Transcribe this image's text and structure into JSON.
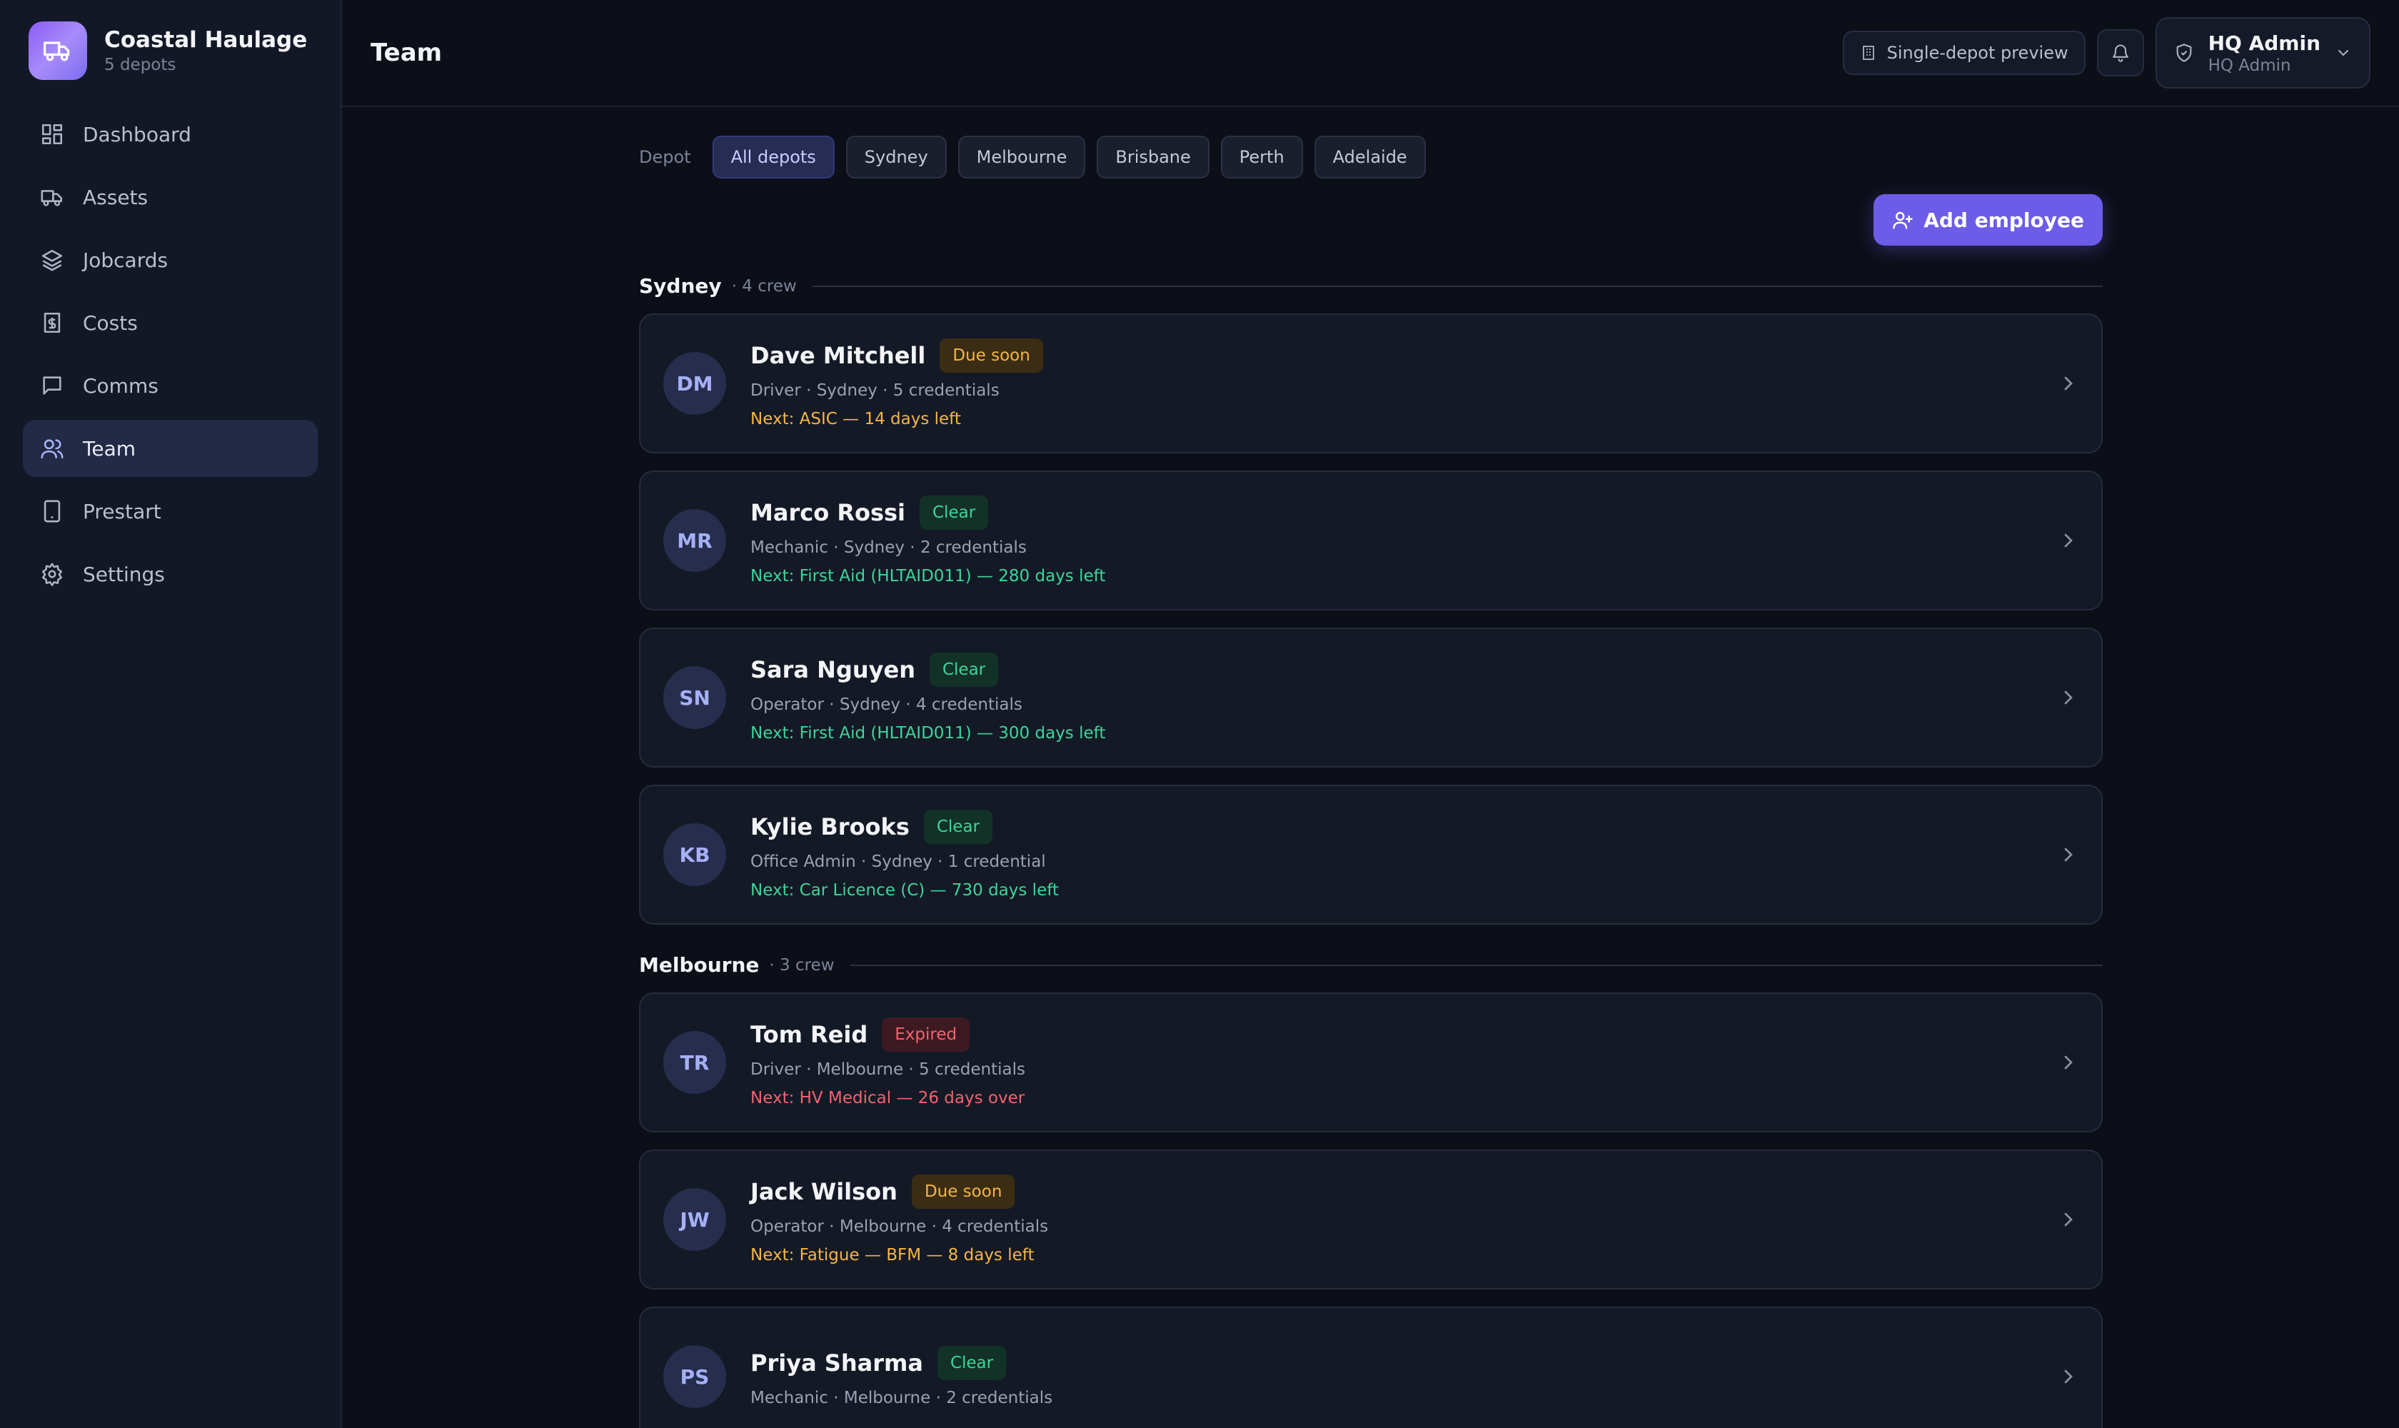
{
  "brand": {
    "name": "Coastal Haulage",
    "subtitle": "5 depots"
  },
  "nav": [
    {
      "label": "Dashboard",
      "icon": "dashboard-icon"
    },
    {
      "label": "Assets",
      "icon": "truck-icon"
    },
    {
      "label": "Jobcards",
      "icon": "layers-icon"
    },
    {
      "label": "Costs",
      "icon": "receipt-icon"
    },
    {
      "label": "Comms",
      "icon": "message-icon"
    },
    {
      "label": "Team",
      "icon": "users-icon",
      "active": true
    },
    {
      "label": "Prestart",
      "icon": "tablet-icon"
    },
    {
      "label": "Settings",
      "icon": "gear-icon"
    }
  ],
  "header": {
    "title": "Team",
    "preview_label": "Single-depot preview",
    "user_name": "HQ Admin",
    "user_role": "HQ Admin"
  },
  "filters": {
    "label": "Depot",
    "options": [
      "All depots",
      "Sydney",
      "Melbourne",
      "Brisbane",
      "Perth",
      "Adelaide"
    ],
    "selected": "All depots"
  },
  "actions": {
    "add_employee": "Add employee"
  },
  "groups": [
    {
      "name": "Sydney",
      "count": "· 4 crew",
      "members": [
        {
          "initials": "DM",
          "name": "Dave Mitchell",
          "status": "Due soon",
          "status_key": "due",
          "meta": "Driver · Sydney · 5 credentials",
          "next": "Next: ASIC — 14 days left"
        },
        {
          "initials": "MR",
          "name": "Marco Rossi",
          "status": "Clear",
          "status_key": "clear",
          "meta": "Mechanic · Sydney · 2 credentials",
          "next": "Next: First Aid (HLTAID011) — 280 days left"
        },
        {
          "initials": "SN",
          "name": "Sara Nguyen",
          "status": "Clear",
          "status_key": "clear",
          "meta": "Operator · Sydney · 4 credentials",
          "next": "Next: First Aid (HLTAID011) — 300 days left"
        },
        {
          "initials": "KB",
          "name": "Kylie Brooks",
          "status": "Clear",
          "status_key": "clear",
          "meta": "Office Admin · Sydney · 1 credential",
          "next": "Next: Car Licence (C) — 730 days left"
        }
      ]
    },
    {
      "name": "Melbourne",
      "count": "· 3 crew",
      "members": [
        {
          "initials": "TR",
          "name": "Tom Reid",
          "status": "Expired",
          "status_key": "expired",
          "meta": "Driver · Melbourne · 5 credentials",
          "next": "Next: HV Medical — 26 days over"
        },
        {
          "initials": "JW",
          "name": "Jack Wilson",
          "status": "Due soon",
          "status_key": "due",
          "meta": "Operator · Melbourne · 4 credentials",
          "next": "Next: Fatigue — BFM — 8 days left"
        },
        {
          "initials": "PS",
          "name": "Priya Sharma",
          "status": "Clear",
          "status_key": "clear",
          "meta": "Mechanic · Melbourne · 2 credentials",
          "next": ""
        }
      ]
    }
  ],
  "colors": {
    "accent": "#6d5ce8",
    "due": "#f5b544",
    "clear": "#3fd49a",
    "expired": "#f2626f",
    "background": "#0c0f18",
    "sidebar": "#131827"
  }
}
